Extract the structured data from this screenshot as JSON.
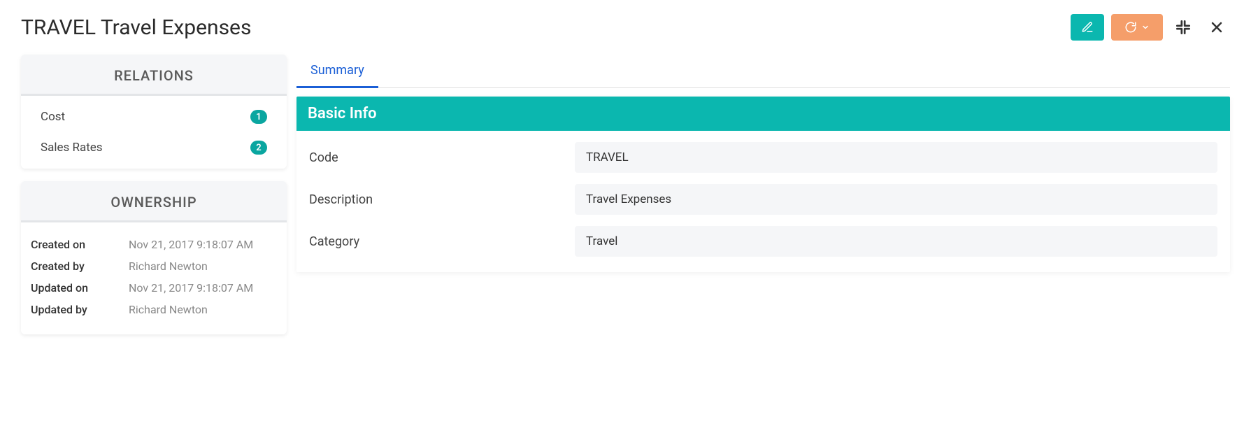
{
  "header": {
    "title": "TRAVEL Travel Expenses"
  },
  "sidebar": {
    "relations": {
      "title": "RELATIONS",
      "items": [
        {
          "label": "Cost",
          "count": "1"
        },
        {
          "label": "Sales Rates",
          "count": "2"
        }
      ]
    },
    "ownership": {
      "title": "OWNERSHIP",
      "rows": [
        {
          "label": "Created on",
          "value": "Nov 21, 2017 9:18:07 AM"
        },
        {
          "label": "Created by",
          "value": "Richard Newton"
        },
        {
          "label": "Updated on",
          "value": "Nov 21, 2017 9:18:07 AM"
        },
        {
          "label": "Updated by",
          "value": "Richard Newton"
        }
      ]
    }
  },
  "main": {
    "tabs": [
      {
        "label": "Summary"
      }
    ],
    "basic_info": {
      "title": "Basic Info",
      "fields": [
        {
          "label": "Code",
          "value": "TRAVEL"
        },
        {
          "label": "Description",
          "value": "Travel Expenses"
        },
        {
          "label": "Category",
          "value": "Travel"
        }
      ]
    }
  }
}
